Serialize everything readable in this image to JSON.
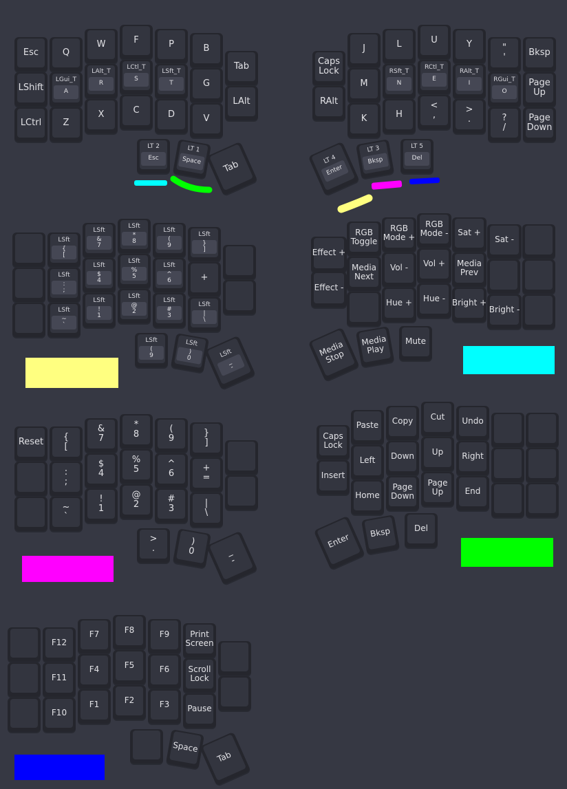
{
  "colors": {
    "cyan": "#00ffff",
    "green": "#00ff00",
    "magenta": "#ff00ff",
    "blue": "#0000ff",
    "yellow": "#ffff80"
  },
  "layer0": {
    "keys": [
      {
        "id": "esc",
        "label": "Esc"
      },
      {
        "id": "q",
        "label": "Q"
      },
      {
        "id": "w",
        "label": "W"
      },
      {
        "id": "f",
        "label": "F"
      },
      {
        "id": "p",
        "label": "P"
      },
      {
        "id": "b",
        "label": "B"
      },
      {
        "id": "tab",
        "label": "Tab"
      },
      {
        "id": "lshift",
        "label": "LShift"
      },
      {
        "id": "a",
        "hold": "LGui_T",
        "label": "A"
      },
      {
        "id": "r",
        "hold": "LAlt_T",
        "label": "R"
      },
      {
        "id": "s",
        "hold": "LCtl_T",
        "label": "S"
      },
      {
        "id": "t",
        "hold": "LSft_T",
        "label": "T"
      },
      {
        "id": "g",
        "label": "G"
      },
      {
        "id": "lalt",
        "label": "LAlt"
      },
      {
        "id": "lctrl",
        "label": "LCtrl"
      },
      {
        "id": "z",
        "label": "Z"
      },
      {
        "id": "x",
        "label": "X"
      },
      {
        "id": "c",
        "label": "C"
      },
      {
        "id": "d",
        "label": "D"
      },
      {
        "id": "v",
        "label": "V"
      },
      {
        "id": "lt2-esc",
        "hold": "LT 2",
        "label": "Esc"
      },
      {
        "id": "lt1-space",
        "hold": "LT 1",
        "label": "Space"
      },
      {
        "id": "tab-thumb",
        "label": "Tab"
      },
      {
        "id": "capslock",
        "label": "Caps Lock"
      },
      {
        "id": "j",
        "label": "J"
      },
      {
        "id": "l",
        "label": "L"
      },
      {
        "id": "u",
        "label": "U"
      },
      {
        "id": "y",
        "label": "Y"
      },
      {
        "id": "quote",
        "label": "\"\n'"
      },
      {
        "id": "bksp",
        "label": "Bksp"
      },
      {
        "id": "ralt",
        "label": "RAlt"
      },
      {
        "id": "m",
        "label": "M"
      },
      {
        "id": "n",
        "hold": "RSft_T",
        "label": "N"
      },
      {
        "id": "e",
        "hold": "RCtl_T",
        "label": "E"
      },
      {
        "id": "i",
        "hold": "RAlt_T",
        "label": "I"
      },
      {
        "id": "o",
        "hold": "RGui_T",
        "label": "O"
      },
      {
        "id": "pgup",
        "label": "Page Up"
      },
      {
        "id": "k",
        "label": "K"
      },
      {
        "id": "h",
        "label": "H"
      },
      {
        "id": "comma",
        "label": "<\n,"
      },
      {
        "id": "dot",
        "label": ">\n."
      },
      {
        "id": "slash",
        "label": "?\n/"
      },
      {
        "id": "pgdn",
        "label": "Page Down"
      },
      {
        "id": "lt4-enter",
        "hold": "LT 4",
        "label": "Enter"
      },
      {
        "id": "lt3-bksp",
        "hold": "LT 3",
        "label": "Bksp"
      },
      {
        "id": "lt5-del",
        "hold": "LT 5",
        "label": "Del"
      }
    ]
  },
  "layer1": {
    "keys": [
      {
        "id": "blank-a",
        "label": ""
      },
      {
        "id": "lbrace",
        "hold": "LSft",
        "label": "{\n["
      },
      {
        "id": "amp",
        "hold": "LSft",
        "label": "&\n7"
      },
      {
        "id": "star",
        "hold": "LSft",
        "label": "*\n8"
      },
      {
        "id": "lparen",
        "hold": "LSft",
        "label": "(\n9"
      },
      {
        "id": "rbrace",
        "hold": "LSft",
        "label": "}\n]"
      },
      {
        "id": "blank-b",
        "label": ""
      },
      {
        "id": "blank-c",
        "label": ""
      },
      {
        "id": "colon",
        "hold": "LSft",
        "label": ":\n;"
      },
      {
        "id": "dollar",
        "hold": "LSft",
        "label": "$\n4"
      },
      {
        "id": "pct",
        "hold": "LSft",
        "label": "%\n5"
      },
      {
        "id": "caret",
        "hold": "LSft",
        "label": "^\n6"
      },
      {
        "id": "plus",
        "label": "+"
      },
      {
        "id": "blank-d",
        "label": ""
      },
      {
        "id": "blank-e",
        "label": ""
      },
      {
        "id": "tilde",
        "hold": "LSft",
        "label": "~\n`"
      },
      {
        "id": "bang",
        "hold": "LSft",
        "label": "!\n1"
      },
      {
        "id": "at",
        "hold": "LSft",
        "label": "@\n2"
      },
      {
        "id": "hash",
        "hold": "LSft",
        "label": "#\n3"
      },
      {
        "id": "pipe",
        "hold": "LSft",
        "label": "|\n\\"
      },
      {
        "id": "th-lparen",
        "hold": "LSft",
        "label": "(\n9"
      },
      {
        "id": "th-rparen",
        "hold": "LSft",
        "label": ")\n0"
      },
      {
        "id": "th-under",
        "hold": "LSft",
        "label": "_\n-"
      }
    ]
  },
  "layer2": {
    "keys": [
      {
        "id": "effplus",
        "label": "Effect +"
      },
      {
        "id": "rgbtog",
        "label": "RGB Toggle"
      },
      {
        "id": "rgbmodeplus",
        "label": "RGB Mode +"
      },
      {
        "id": "rgbmodeminus",
        "label": "RGB Mode -"
      },
      {
        "id": "satplus",
        "label": "Sat +"
      },
      {
        "id": "satminus",
        "label": "Sat -"
      },
      {
        "id": "blank-r1",
        "label": ""
      },
      {
        "id": "effminus",
        "label": "Effect -"
      },
      {
        "id": "mnext",
        "label": "Media Next"
      },
      {
        "id": "volminus",
        "label": "Vol -"
      },
      {
        "id": "volplus",
        "label": "Vol +"
      },
      {
        "id": "mprev",
        "label": "Media Prev"
      },
      {
        "id": "blank-r2",
        "label": ""
      },
      {
        "id": "blank-r3",
        "label": ""
      },
      {
        "id": "blank-r4",
        "label": ""
      },
      {
        "id": "hueplus",
        "label": "Hue +"
      },
      {
        "id": "hueminus",
        "label": "Hue -"
      },
      {
        "id": "brightplus",
        "label": "Bright +"
      },
      {
        "id": "brightminus",
        "label": "Bright -"
      },
      {
        "id": "blank-r5",
        "label": ""
      },
      {
        "id": "mstop",
        "label": "Media Stop"
      },
      {
        "id": "mplay",
        "label": "Media Play"
      },
      {
        "id": "mute",
        "label": "Mute"
      }
    ]
  },
  "layer3": {
    "keys": [
      {
        "id": "reset",
        "label": "Reset"
      },
      {
        "id": "lbrace",
        "label": "{\n["
      },
      {
        "id": "amp",
        "label": "&\n7"
      },
      {
        "id": "star",
        "label": "*\n8"
      },
      {
        "id": "lparen",
        "label": "(\n9"
      },
      {
        "id": "rbrace",
        "label": "}\n]"
      },
      {
        "id": "blank-a",
        "label": ""
      },
      {
        "id": "blank-b",
        "label": ""
      },
      {
        "id": "colon",
        "label": ":\n;"
      },
      {
        "id": "dollar",
        "label": "$\n4"
      },
      {
        "id": "pct",
        "label": "%\n5"
      },
      {
        "id": "caret",
        "label": "^\n6"
      },
      {
        "id": "plus",
        "label": "+\n="
      },
      {
        "id": "blank-c",
        "label": ""
      },
      {
        "id": "blank-d",
        "label": ""
      },
      {
        "id": "tilde",
        "label": "~\n`"
      },
      {
        "id": "bang",
        "label": "!\n1"
      },
      {
        "id": "at",
        "label": "@\n2"
      },
      {
        "id": "hash",
        "label": "#\n3"
      },
      {
        "id": "pipe",
        "label": "|\n\\"
      },
      {
        "id": "th-gt",
        "label": ">\n."
      },
      {
        "id": "th-rparen",
        "label": ")\n0"
      },
      {
        "id": "th-under",
        "label": "_\n-"
      }
    ]
  },
  "layer4": {
    "keys": [
      {
        "id": "capslock",
        "label": "Caps Lock"
      },
      {
        "id": "paste",
        "label": "Paste"
      },
      {
        "id": "copy",
        "label": "Copy"
      },
      {
        "id": "cut",
        "label": "Cut"
      },
      {
        "id": "undo",
        "label": "Undo"
      },
      {
        "id": "blank-1",
        "label": ""
      },
      {
        "id": "blank-2",
        "label": ""
      },
      {
        "id": "insert",
        "label": "Insert"
      },
      {
        "id": "left",
        "label": "Left"
      },
      {
        "id": "down",
        "label": "Down"
      },
      {
        "id": "up",
        "label": "Up"
      },
      {
        "id": "right",
        "label": "Right"
      },
      {
        "id": "blank-3",
        "label": ""
      },
      {
        "id": "blank-4",
        "label": ""
      },
      {
        "id": "home",
        "label": "Home"
      },
      {
        "id": "pgdn",
        "label": "Page Down"
      },
      {
        "id": "pgup",
        "label": "Page Up"
      },
      {
        "id": "end",
        "label": "End"
      },
      {
        "id": "blank-5",
        "label": ""
      },
      {
        "id": "blank-6",
        "label": ""
      },
      {
        "id": "enter",
        "label": "Enter"
      },
      {
        "id": "bksp",
        "label": "Bksp"
      },
      {
        "id": "del",
        "label": "Del"
      }
    ]
  },
  "layer5": {
    "keys": [
      {
        "id": "blank-1",
        "label": ""
      },
      {
        "id": "f12",
        "label": "F12"
      },
      {
        "id": "f7",
        "label": "F7"
      },
      {
        "id": "f8",
        "label": "F8"
      },
      {
        "id": "f9",
        "label": "F9"
      },
      {
        "id": "prtsc",
        "label": "Print Screen"
      },
      {
        "id": "blank-2",
        "label": ""
      },
      {
        "id": "blank-3",
        "label": ""
      },
      {
        "id": "f11",
        "label": "F11"
      },
      {
        "id": "f4",
        "label": "F4"
      },
      {
        "id": "f5",
        "label": "F5"
      },
      {
        "id": "f6",
        "label": "F6"
      },
      {
        "id": "scrlk",
        "label": "Scroll Lock"
      },
      {
        "id": "blank-4",
        "label": ""
      },
      {
        "id": "blank-5",
        "label": ""
      },
      {
        "id": "f10",
        "label": "F10"
      },
      {
        "id": "f1",
        "label": "F1"
      },
      {
        "id": "f2",
        "label": "F2"
      },
      {
        "id": "f3",
        "label": "F3"
      },
      {
        "id": "pause",
        "label": "Pause"
      },
      {
        "id": "blank-6",
        "label": ""
      },
      {
        "id": "space",
        "label": "Space"
      },
      {
        "id": "tab",
        "label": "Tab"
      }
    ]
  }
}
